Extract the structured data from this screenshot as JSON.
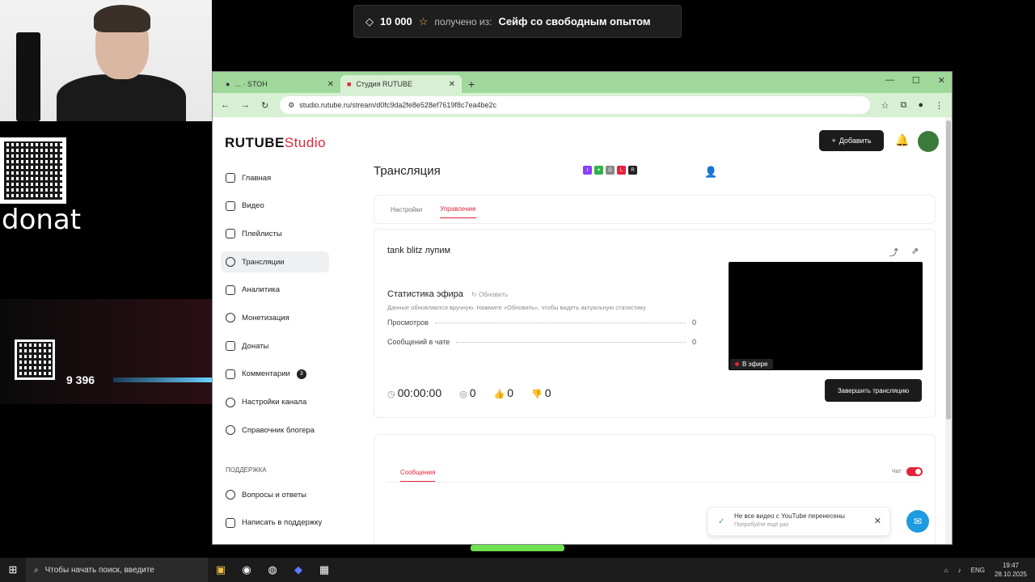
{
  "overlay": {
    "toast_amount": "10 000",
    "toast_from": "получено из:",
    "toast_source": "Сейф со свободным опытом",
    "donat_label": "donat",
    "goal_count": "9 396"
  },
  "browser": {
    "tabs": [
      {
        "label": "... · STOH"
      },
      {
        "label": "Студия RUTUBE"
      }
    ],
    "url": "studio.rutube.ru/stream/d0fc9da2fe8e528ef7619f8c7ea4be2c"
  },
  "header": {
    "logo_main": "RUTUBE",
    "logo_sub": "Studio",
    "add_label": "Добавить"
  },
  "sidebar": {
    "items": [
      {
        "label": "Главная"
      },
      {
        "label": "Видео"
      },
      {
        "label": "Плейлисты"
      },
      {
        "label": "Трансляции"
      },
      {
        "label": "Аналитика"
      },
      {
        "label": "Монетизация"
      },
      {
        "label": "Донаты"
      },
      {
        "label": "Комментарии",
        "badge": "3"
      },
      {
        "label": "Настройки канала"
      },
      {
        "label": "Справочник блогера"
      }
    ],
    "support_heading": "ПОДДЕРЖКА",
    "support_items": [
      {
        "label": "Вопросы и ответы"
      },
      {
        "label": "Написать в поддержку"
      }
    ]
  },
  "main": {
    "title": "Трансляция",
    "tabs": [
      {
        "label": "Настройки"
      },
      {
        "label": "Управление"
      }
    ],
    "stream_title": "tank blitz лупим",
    "stats_heading": "Статистика эфира",
    "refresh_label": "Обновить",
    "stats_note": "Данные обновляются вручную. Нажмите «Обновить», чтобы видеть актуальную статистику",
    "stats": [
      {
        "label": "Просмотров",
        "value": "0"
      },
      {
        "label": "Сообщений в чате",
        "value": "0"
      }
    ],
    "live_label": "В эфире",
    "timer": "00:00:00",
    "viewers": "0",
    "likes": "0",
    "dislikes": "0",
    "end_button": "Завершить трансляцию",
    "chat_tab": "Сообщения",
    "chat_toggle_label": "Чат"
  },
  "notification": {
    "title": "Не все видео с YouTube перенесены",
    "subtitle": "Попробуйте ещё раз"
  },
  "taskbar": {
    "search_placeholder": "Чтобы начать поиск, введите",
    "lang": "ENG",
    "time": "19:47",
    "date": "28.10.2025"
  },
  "colors": {
    "accent": "#e3243b",
    "tab_bar": "#9fd89a",
    "help": "#1e9be0"
  }
}
